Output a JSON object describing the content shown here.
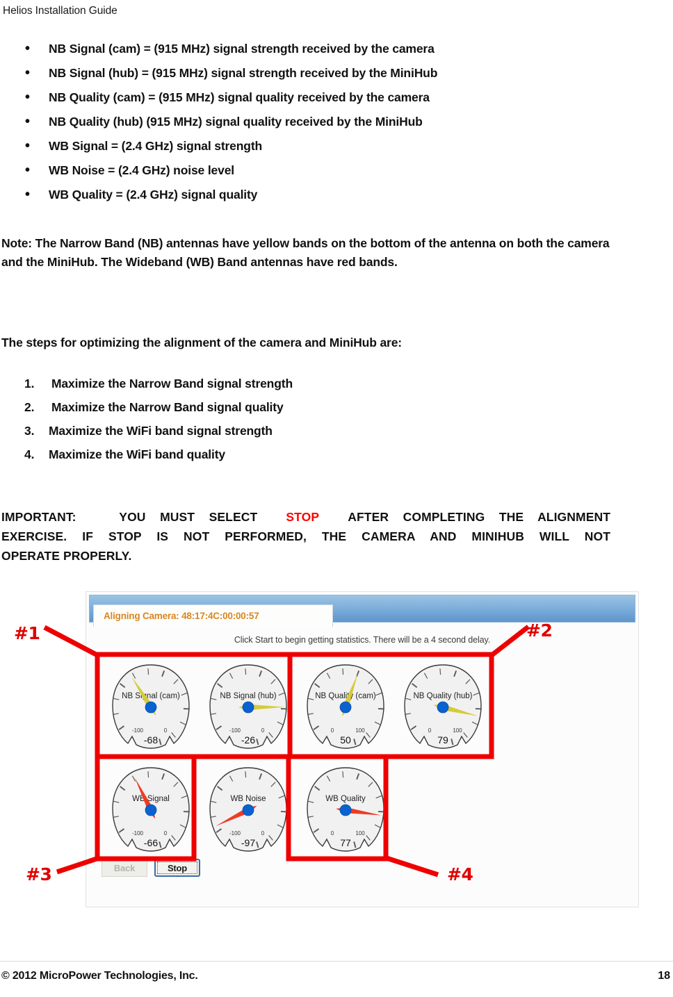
{
  "document": {
    "header": "Helios Installation Guide",
    "footer_copyright": "© 2012 MicroPower Technologies, Inc.",
    "page_number": "18"
  },
  "definitions": {
    "items": [
      "NB Signal (cam) = (915 MHz) signal strength received by the camera",
      "NB Signal (hub) = (915 MHz) signal strength received by the MiniHub",
      "NB Quality (cam) = (915 MHz) signal quality received by the camera",
      "NB Quality (hub) (915 MHz) signal quality received by the MiniHub",
      "WB Signal = (2.4 GHz) signal strength",
      "WB Noise =  (2.4 GHz) noise level",
      "WB Quality =  (2.4 GHz) signal quality"
    ],
    "bullet_glyph": "•"
  },
  "note": {
    "text": "Note:  The Narrow Band (NB) antennas have yellow bands on the bottom of the antenna on both the camera and the MiniHub.   The Wideband (WB) Band antennas have red bands."
  },
  "steps": {
    "intro": "The steps for optimizing the alignment of the camera and MiniHub are:",
    "items": [
      {
        "num": "1.",
        "label": "Maximize the Narrow Band signal strength"
      },
      {
        "num": "2.",
        "label": "Maximize the Narrow Band signal quality"
      },
      {
        "num": "3.",
        "label": "Maximize the WiFi band signal strength"
      },
      {
        "num": "4.",
        "label": "Maximize the WiFi band quality"
      }
    ]
  },
  "important": {
    "line1_a": "IMPORTANT:",
    "line1_b": "YOU   MUST   SELECT",
    "stop_word": "STOP",
    "line1_c": "AFTER   COMPLETING   THE   ALIGNMENT",
    "line2": "EXERCISE.   IF  STOP  IS  NOT  PERFORMED,  THE  CAMERA  AND  MINIHUB  WILL  NOT",
    "line3": "OPERATE PROPERLY."
  },
  "app": {
    "tab_label": "Aligning Camera: 48:17:4C:00:00:57",
    "hint": "Click Start to begin getting statistics. There will be a 4 second delay.",
    "buttons": {
      "back": "Back",
      "stop": "Stop"
    },
    "colors": {
      "titlebar": "#7fb0dc",
      "tab_text": "#d98620",
      "needle_nb": "#d4cc3a",
      "needle_wb": "#ef3b24",
      "hub": "#0a62d0",
      "annotation": "#e00000"
    }
  },
  "chart_data": {
    "type": "gauge",
    "title": "Aligning Camera: 48:17:4C:00:00:57",
    "gauges": [
      {
        "label": "NB Signal (cam)",
        "value": -68,
        "min": -100,
        "max": 0,
        "min_tick": "-100",
        "max_tick": "0",
        "display": "-68",
        "needle": "#d4cc3a",
        "row": 1,
        "col": 1
      },
      {
        "label": "NB Signal (hub)",
        "value": -26,
        "min": -100,
        "max": 0,
        "min_tick": "-100",
        "max_tick": "0",
        "display": "-26",
        "needle": "#d4cc3a",
        "row": 1,
        "col": 2
      },
      {
        "label": "NB Quality (cam)",
        "value": 50,
        "min": 0,
        "max": 100,
        "min_tick": "0",
        "max_tick": "100",
        "display": "50",
        "needle": "#d4cc3a",
        "row": 1,
        "col": 3
      },
      {
        "label": "NB Quality (hub)",
        "value": 79,
        "min": 0,
        "max": 100,
        "min_tick": "0",
        "max_tick": "100",
        "display": "79",
        "needle": "#d4cc3a",
        "row": 1,
        "col": 4
      },
      {
        "label": "WB Signal",
        "value": -66,
        "min": -100,
        "max": 0,
        "min_tick": "-100",
        "max_tick": "0",
        "display": "-66",
        "needle": "#ef3b24",
        "row": 2,
        "col": 1
      },
      {
        "label": "WB Noise",
        "value": -97,
        "min": -100,
        "max": 0,
        "min_tick": "-100",
        "max_tick": "0",
        "display": "-97",
        "needle": "#ef3b24",
        "row": 2,
        "col": 2
      },
      {
        "label": "WB Quality",
        "value": 77,
        "min": 0,
        "max": 100,
        "min_tick": "0",
        "max_tick": "100",
        "display": "77",
        "needle": "#ef3b24",
        "row": 2,
        "col": 3
      }
    ]
  },
  "annotations": {
    "markers": [
      {
        "id": "#1",
        "target": "NB Signal gauges"
      },
      {
        "id": "#2",
        "target": "NB Quality gauges"
      },
      {
        "id": "#3",
        "target": "WB Signal gauge"
      },
      {
        "id": "#4",
        "target": "WB Quality gauge"
      }
    ]
  }
}
